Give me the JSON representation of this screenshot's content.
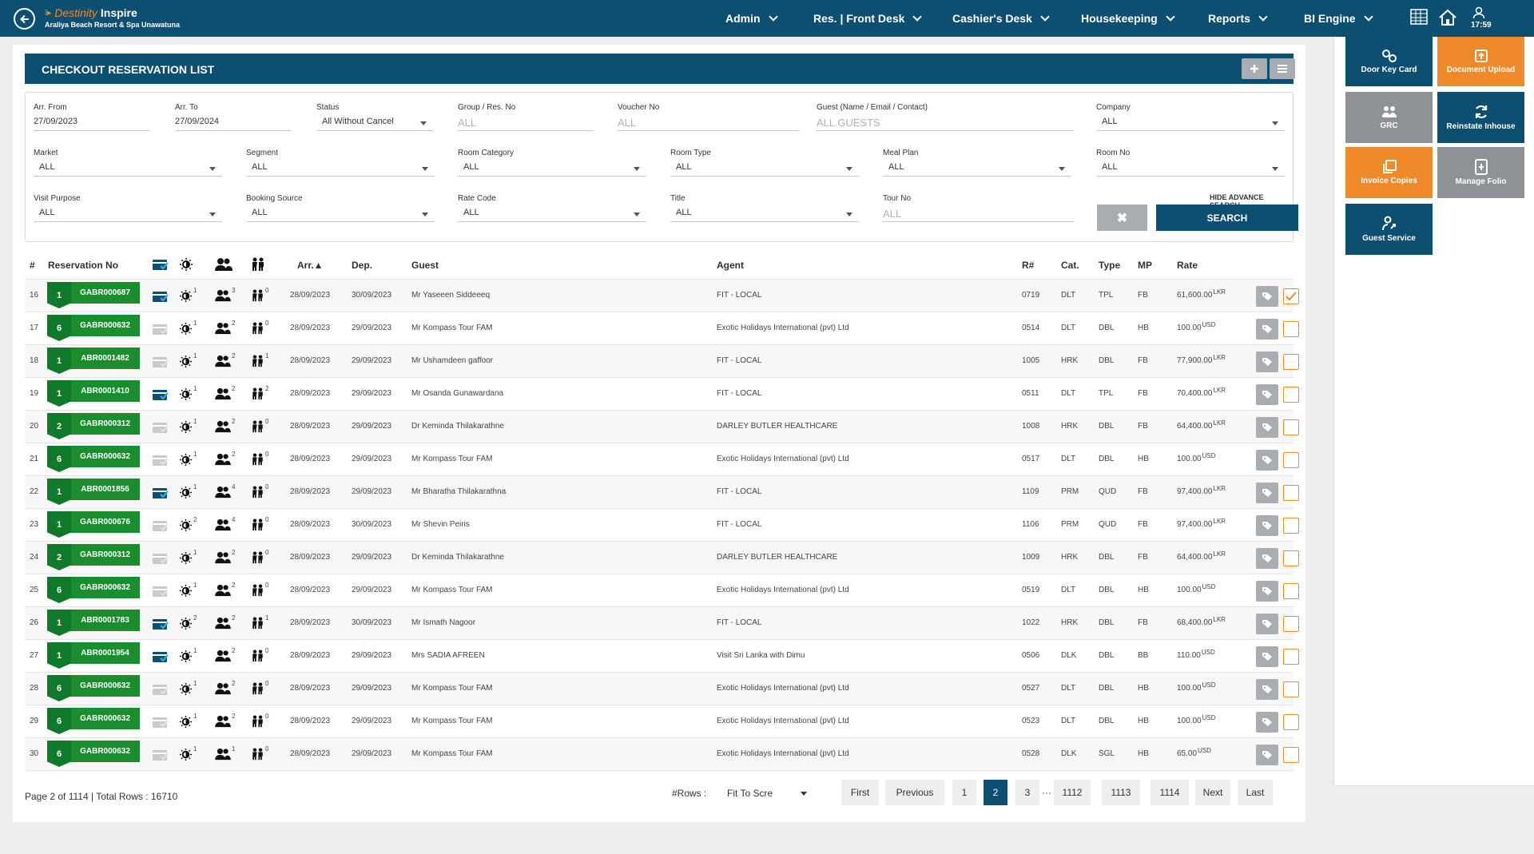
{
  "app": {
    "brand_name": "Destinity",
    "product": "Inspire",
    "hotel": "Araliya Beach Resort & Spa Unawatuna",
    "clock": "17:59"
  },
  "nav": [
    "Admin",
    "Res. | Front Desk",
    "Cashier's Desk",
    "Housekeeping",
    "Reports",
    "BI Engine"
  ],
  "panel": {
    "title": "CHECKOUT RESERVATION LIST"
  },
  "filters": {
    "arr_from": {
      "label": "Arr. From",
      "value": "27/09/2023"
    },
    "arr_to": {
      "label": "Arr. To",
      "value": "27/09/2024"
    },
    "status": {
      "label": "Status",
      "value": "All Without Cancel"
    },
    "group": {
      "label": "Group / Res. No",
      "placeholder": "ALL"
    },
    "voucher": {
      "label": "Voucher No",
      "placeholder": "ALL"
    },
    "guest": {
      "label": "Guest (Name / Email / Contact)",
      "placeholder": "ALL GUESTS"
    },
    "company": {
      "label": "Company",
      "value": "ALL"
    },
    "market": {
      "label": "Market",
      "value": "ALL"
    },
    "segment": {
      "label": "Segment",
      "value": "ALL"
    },
    "room_category": {
      "label": "Room Category",
      "value": "ALL"
    },
    "room_type": {
      "label": "Room Type",
      "value": "ALL"
    },
    "meal_plan": {
      "label": "Meal Plan",
      "value": "ALL"
    },
    "room_no": {
      "label": "Room No",
      "value": "ALL"
    },
    "visit_purpose": {
      "label": "Visit Purpose",
      "value": "ALL"
    },
    "booking_source": {
      "label": "Booking Source",
      "value": "ALL"
    },
    "rate_code": {
      "label": "Rate Code",
      "value": "ALL"
    },
    "title": {
      "label": "Title",
      "value": "ALL"
    },
    "tour_no": {
      "label": "Tour No",
      "placeholder": "ALL"
    },
    "hide_advance": "HIDE ADVANCE SEARCH",
    "search_label": "SEARCH",
    "clear_label": "✖"
  },
  "table": {
    "headers": {
      "num": "#",
      "res_no": "Reservation No",
      "arr": "Arr.▲",
      "dep": "Dep.",
      "guest": "Guest",
      "agent": "Agent",
      "room": "R#",
      "cat": "Cat.",
      "type": "Type",
      "mp": "MP",
      "rate": "Rate"
    },
    "rows": [
      {
        "num": "16",
        "badge": "1",
        "res": "GABR000687",
        "card": true,
        "day": "1",
        "adult": "3",
        "child": "0",
        "arr": "28/09/2023",
        "dep": "30/09/2023",
        "guest": "Mr Yaseeen Siddeeeq",
        "agent": "FIT - LOCAL",
        "room": "0719",
        "cat": "DLT",
        "type": "TPL",
        "mp": "FB",
        "rate": "61,600.00",
        "cur": "LKR",
        "checked": true
      },
      {
        "num": "17",
        "badge": "6",
        "res": "GABR000632",
        "card": false,
        "day": "1",
        "adult": "2",
        "child": "0",
        "arr": "28/09/2023",
        "dep": "29/09/2023",
        "guest": "Mr Kompass Tour FAM",
        "agent": "Exotic Holidays International (pvt) Ltd",
        "room": "0514",
        "cat": "DLT",
        "type": "DBL",
        "mp": "HB",
        "rate": "100.00",
        "cur": "USD",
        "checked": false
      },
      {
        "num": "18",
        "badge": "1",
        "res": "ABR0001482",
        "card": false,
        "day": "1",
        "adult": "2",
        "child": "1",
        "arr": "28/09/2023",
        "dep": "29/09/2023",
        "guest": "Mr Ushamdeen gaffoor",
        "agent": "FIT - LOCAL",
        "room": "1005",
        "cat": "HRK",
        "type": "DBL",
        "mp": "FB",
        "rate": "77,900.00",
        "cur": "LKR",
        "checked": false
      },
      {
        "num": "19",
        "badge": "1",
        "res": "ABR0001410",
        "card": true,
        "day": "1",
        "adult": "2",
        "child": "2",
        "arr": "28/09/2023",
        "dep": "29/09/2023",
        "guest": "Mr Osanda Gunawardana",
        "agent": "FIT - LOCAL",
        "room": "0511",
        "cat": "DLT",
        "type": "TPL",
        "mp": "FB",
        "rate": "70,400.00",
        "cur": "LKR",
        "checked": false
      },
      {
        "num": "20",
        "badge": "2",
        "res": "GABR000312",
        "card": false,
        "day": "1",
        "adult": "2",
        "child": "0",
        "arr": "28/09/2023",
        "dep": "29/09/2023",
        "guest": "Dr Keminda Thilakarathne",
        "agent": "DARLEY BUTLER HEALTHCARE",
        "room": "1008",
        "cat": "HRK",
        "type": "DBL",
        "mp": "FB",
        "rate": "64,400.00",
        "cur": "LKR",
        "checked": false
      },
      {
        "num": "21",
        "badge": "6",
        "res": "GABR000632",
        "card": false,
        "day": "1",
        "adult": "2",
        "child": "0",
        "arr": "28/09/2023",
        "dep": "29/09/2023",
        "guest": "Mr Kompass Tour FAM",
        "agent": "Exotic Holidays International (pvt) Ltd",
        "room": "0517",
        "cat": "DLT",
        "type": "DBL",
        "mp": "HB",
        "rate": "100.00",
        "cur": "USD",
        "checked": false
      },
      {
        "num": "22",
        "badge": "1",
        "res": "ABR0001856",
        "card": true,
        "day": "1",
        "adult": "4",
        "child": "0",
        "arr": "28/09/2023",
        "dep": "29/09/2023",
        "guest": "Mr Bharatha Thilakarathna",
        "agent": "FIT - LOCAL",
        "room": "1109",
        "cat": "PRM",
        "type": "QUD",
        "mp": "FB",
        "rate": "97,400.00",
        "cur": "LKR",
        "checked": false
      },
      {
        "num": "23",
        "badge": "1",
        "res": "GABR000676",
        "card": false,
        "day": "2",
        "adult": "4",
        "child": "0",
        "arr": "28/09/2023",
        "dep": "30/09/2023",
        "guest": "Mr Shevin Peiris",
        "agent": "FIT - LOCAL",
        "room": "1106",
        "cat": "PRM",
        "type": "QUD",
        "mp": "FB",
        "rate": "97,400.00",
        "cur": "LKR",
        "checked": false
      },
      {
        "num": "24",
        "badge": "2",
        "res": "GABR000312",
        "card": false,
        "day": "1",
        "adult": "2",
        "child": "0",
        "arr": "28/09/2023",
        "dep": "29/09/2023",
        "guest": "Dr Keminda Thilakarathne",
        "agent": "DARLEY BUTLER HEALTHCARE",
        "room": "1009",
        "cat": "HRK",
        "type": "DBL",
        "mp": "FB",
        "rate": "64,400.00",
        "cur": "LKR",
        "checked": false
      },
      {
        "num": "25",
        "badge": "6",
        "res": "GABR000632",
        "card": false,
        "day": "1",
        "adult": "2",
        "child": "0",
        "arr": "28/09/2023",
        "dep": "29/09/2023",
        "guest": "Mr Kompass Tour FAM",
        "agent": "Exotic Holidays International (pvt) Ltd",
        "room": "0519",
        "cat": "DLT",
        "type": "DBL",
        "mp": "HB",
        "rate": "100.00",
        "cur": "USD",
        "checked": false
      },
      {
        "num": "26",
        "badge": "1",
        "res": "ABR0001783",
        "card": true,
        "day": "2",
        "adult": "2",
        "child": "1",
        "arr": "28/09/2023",
        "dep": "30/09/2023",
        "guest": "Mr Ismath Nagoor",
        "agent": "FIT - LOCAL",
        "room": "1022",
        "cat": "HRK",
        "type": "DBL",
        "mp": "FB",
        "rate": "68,400.00",
        "cur": "LKR",
        "checked": false
      },
      {
        "num": "27",
        "badge": "1",
        "res": "ABR0001954",
        "card": true,
        "day": "1",
        "adult": "2",
        "child": "0",
        "arr": "28/09/2023",
        "dep": "29/09/2023",
        "guest": "Mrs SADIA AFREEN",
        "agent": "Visit Sri Lanka with Dimu",
        "room": "0506",
        "cat": "DLK",
        "type": "DBL",
        "mp": "BB",
        "rate": "110.00",
        "cur": "USD",
        "checked": false
      },
      {
        "num": "28",
        "badge": "6",
        "res": "GABR000632",
        "card": false,
        "day": "1",
        "adult": "2",
        "child": "0",
        "arr": "28/09/2023",
        "dep": "29/09/2023",
        "guest": "Mr Kompass Tour FAM",
        "agent": "Exotic Holidays International (pvt) Ltd",
        "room": "0527",
        "cat": "DLT",
        "type": "DBL",
        "mp": "HB",
        "rate": "100.00",
        "cur": "USD",
        "checked": false
      },
      {
        "num": "29",
        "badge": "6",
        "res": "GABR000632",
        "card": false,
        "day": "1",
        "adult": "2",
        "child": "0",
        "arr": "28/09/2023",
        "dep": "29/09/2023",
        "guest": "Mr Kompass Tour FAM",
        "agent": "Exotic Holidays International (pvt) Ltd",
        "room": "0523",
        "cat": "DLT",
        "type": "DBL",
        "mp": "HB",
        "rate": "100.00",
        "cur": "USD",
        "checked": false
      },
      {
        "num": "30",
        "badge": "6",
        "res": "GABR000632",
        "card": false,
        "day": "1",
        "adult": "1",
        "child": "0",
        "arr": "28/09/2023",
        "dep": "29/09/2023",
        "guest": "Mr Kompass Tour FAM",
        "agent": "Exotic Holidays International (pvt) Ltd",
        "room": "0528",
        "cat": "DLK",
        "type": "SGL",
        "mp": "HB",
        "rate": "65.00",
        "cur": "USD",
        "checked": false
      }
    ]
  },
  "footer": {
    "info": "Page 2 of 1114 | Total Rows : 16710",
    "rows_label": "#Rows :",
    "rows_value": "Fit To Scre",
    "pages": [
      "First",
      "Previous",
      "1",
      "2",
      "3",
      "···",
      "1112",
      "1113",
      "1114",
      "Next",
      "Last"
    ]
  },
  "actions": [
    {
      "label": "Door Key Card",
      "icon": "door-key-icon",
      "color": "blue"
    },
    {
      "label": "Document Upload",
      "icon": "upload-icon",
      "color": "orange"
    },
    {
      "label": "GRC",
      "icon": "grc-icon",
      "color": "grey"
    },
    {
      "label": "Reinstate Inhouse",
      "icon": "refresh-icon",
      "color": "blue"
    },
    {
      "label": "Invoice Copies",
      "icon": "copies-icon",
      "color": "orange"
    },
    {
      "label": "Manage Folio",
      "icon": "folio-icon",
      "color": "grey"
    },
    {
      "label": "Guest Service",
      "icon": "guest-service-icon",
      "color": "blue"
    }
  ]
}
